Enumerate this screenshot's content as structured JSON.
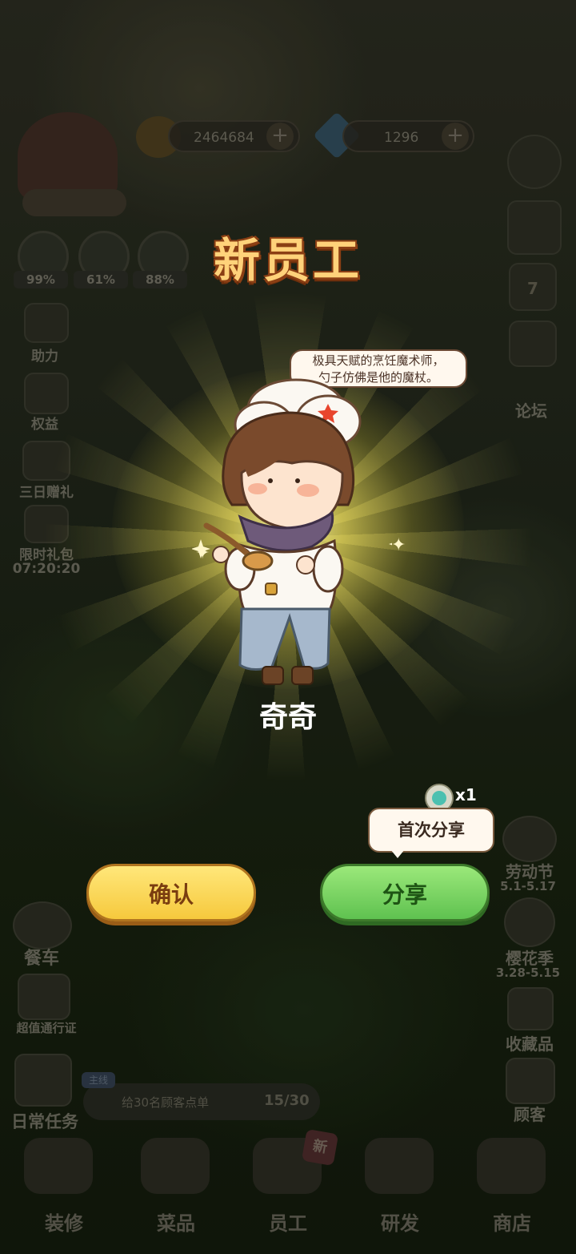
{
  "top_bar": {
    "coins": "2464684",
    "gems": "1296",
    "plus": "+"
  },
  "stats": [
    {
      "label": "99%"
    },
    {
      "label": "61%"
    },
    {
      "label": "88%"
    }
  ],
  "left_menu": {
    "help": "助力",
    "rights": "权益",
    "three_day_gift": "三日赠礼",
    "limited_pack": "限时礼包",
    "limited_pack_timer": "07:20:20",
    "food_truck": "餐车",
    "pass": "超值通行证",
    "daily_tasks": "日常任务"
  },
  "right_menu": {
    "forum": "论坛",
    "calendar_day": "7",
    "labor_day": "劳动节",
    "labor_day_dates": "5.1-5.17",
    "sakura": "樱花季",
    "sakura_dates": "3.28-5.15",
    "collection": "收藏品",
    "customers": "顾客"
  },
  "task": {
    "tag": "主线",
    "text": "给30名顾客点单",
    "progress": "15/30"
  },
  "bottom_nav": [
    {
      "label": "装修"
    },
    {
      "label": "菜品"
    },
    {
      "label": "员工",
      "badge": "新"
    },
    {
      "label": "研发"
    },
    {
      "label": "商店"
    }
  ],
  "popup": {
    "title": "新员工",
    "speech_line1": "极具天赋的烹饪魔术师，",
    "speech_line2": "勺子仿佛是他的魔杖。",
    "name": "奇奇",
    "confirm_label": "确认",
    "share_label": "分享",
    "first_share_tip": "首次分享",
    "reward_count": "x1"
  }
}
